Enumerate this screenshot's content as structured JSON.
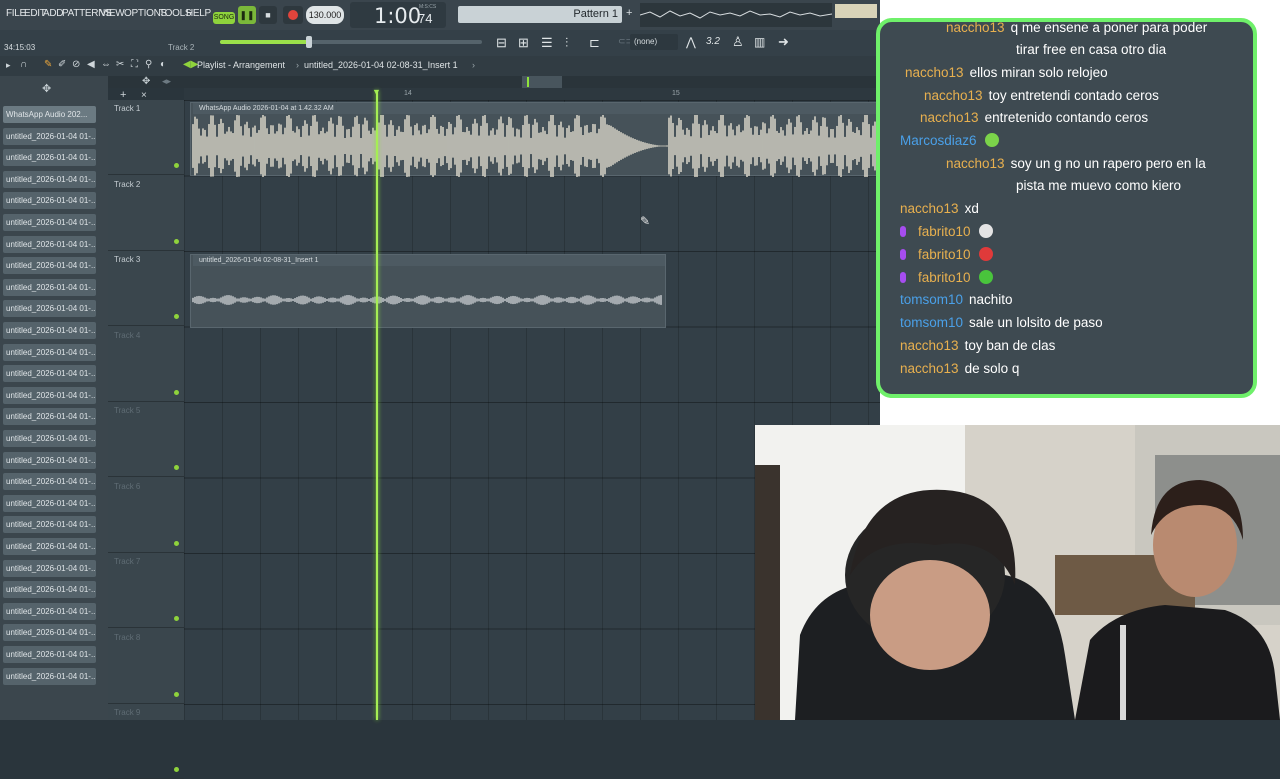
{
  "menu": [
    "FILE",
    "EDIT",
    "ADD",
    "PATTERNS",
    "VIEW",
    "OPTIONS",
    "TOOLS",
    "HELP"
  ],
  "transport": {
    "song_label": "SONG",
    "tempo": "130.000",
    "time": "1:00",
    "time_frac": "74",
    "time_unit": "M:S:CS",
    "pattern": "Pattern 1",
    "cpu_top": "10",
    "cpu_top2": "10",
    "hint_time": "34:15:03",
    "hint_track": "Track 2",
    "snap": "(none)",
    "snap_value": "3.2"
  },
  "playlist": {
    "title": "Playlist - Arrangement",
    "breadcrumb": "untitled_2026-01-04 02-08-31_Insert 1",
    "ruler_marks": [
      "14",
      "15"
    ]
  },
  "browser_items": [
    "WhatsApp Audio 202...",
    "untitled_2026-01-04 01-...",
    "untitled_2026-01-04 01-...",
    "untitled_2026-01-04 01-...",
    "untitled_2026-01-04 01-...",
    "untitled_2026-01-04 01-...",
    "untitled_2026-01-04 01-...",
    "untitled_2026-01-04 01-...",
    "untitled_2026-01-04 01-...",
    "untitled_2026-01-04 01-...",
    "untitled_2026-01-04 01-...",
    "untitled_2026-01-04 01-...",
    "untitled_2026-01-04 01-...",
    "untitled_2026-01-04 01-...",
    "untitled_2026-01-04 01-...",
    "untitled_2026-01-04 01-...",
    "untitled_2026-01-04 01-...",
    "untitled_2026-01-04 01-...",
    "untitled_2026-01-04 01-...",
    "untitled_2026-01-04 01-...",
    "untitled_2026-01-04 01-...",
    "untitled_2026-01-04 01-...",
    "untitled_2026-01-04 01-...",
    "untitled_2026-01-04 01-...",
    "untitled_2026-01-04 01-...",
    "untitled_2026-01-04 01-...",
    "untitled_2026-01-04 01-..."
  ],
  "tracks": [
    "Track 1",
    "Track 2",
    "Track 3",
    "Track 4",
    "Track 5",
    "Track 6",
    "Track 7",
    "Track 8",
    "Track 9"
  ],
  "clips": {
    "track1": "WhatsApp Audio 2026-01-04 at 1.42.32 AM",
    "track3": "untitled_2026-01-04 02-08-31_Insert 1"
  },
  "chat": [
    {
      "user": "naccho13",
      "text": "q me ensene a poner para poder",
      "color": "#e8b04f"
    },
    {
      "user": "",
      "text": "tirar free en casa otro dia",
      "color": "#e8b04f"
    },
    {
      "user": "naccho13",
      "text": "ellos miran solo relojeo",
      "color": "#e8b04f"
    },
    {
      "user": "naccho13",
      "text": "toy entretendi contado ceros",
      "color": "#e8b04f"
    },
    {
      "user": "naccho13",
      "text": "entretenido contando ceros",
      "color": "#e8b04f"
    },
    {
      "user": "Marcosdiaz6",
      "text": "",
      "color": "#4aa0e8"
    },
    {
      "user": "naccho13",
      "text": "soy un g no un rapero pero en la",
      "color": "#e8b04f"
    },
    {
      "user": "",
      "text": "pista me muevo como kiero",
      "color": "#e8b04f"
    },
    {
      "user": "naccho13",
      "text": "xd",
      "color": "#e8b04f"
    },
    {
      "user": "fabrito10",
      "text": "",
      "color": "#e8b04f"
    },
    {
      "user": "fabrito10",
      "text": "",
      "color": "#e8b04f"
    },
    {
      "user": "fabrito10",
      "text": "",
      "color": "#e8b04f"
    },
    {
      "user": "tomsom10",
      "text": "nachito",
      "color": "#4aa0e8"
    },
    {
      "user": "tomsom10",
      "text": "sale un lolsito de paso",
      "color": "#4aa0e8"
    },
    {
      "user": "naccho13",
      "text": "toy ban de clas",
      "color": "#e8b04f"
    },
    {
      "user": "naccho13",
      "text": "de solo q",
      "color": "#e8b04f"
    }
  ],
  "colors": {
    "accent": "#8fe33c",
    "chat_border": "#6ff06a",
    "chat_bg": "#3e4a51"
  }
}
